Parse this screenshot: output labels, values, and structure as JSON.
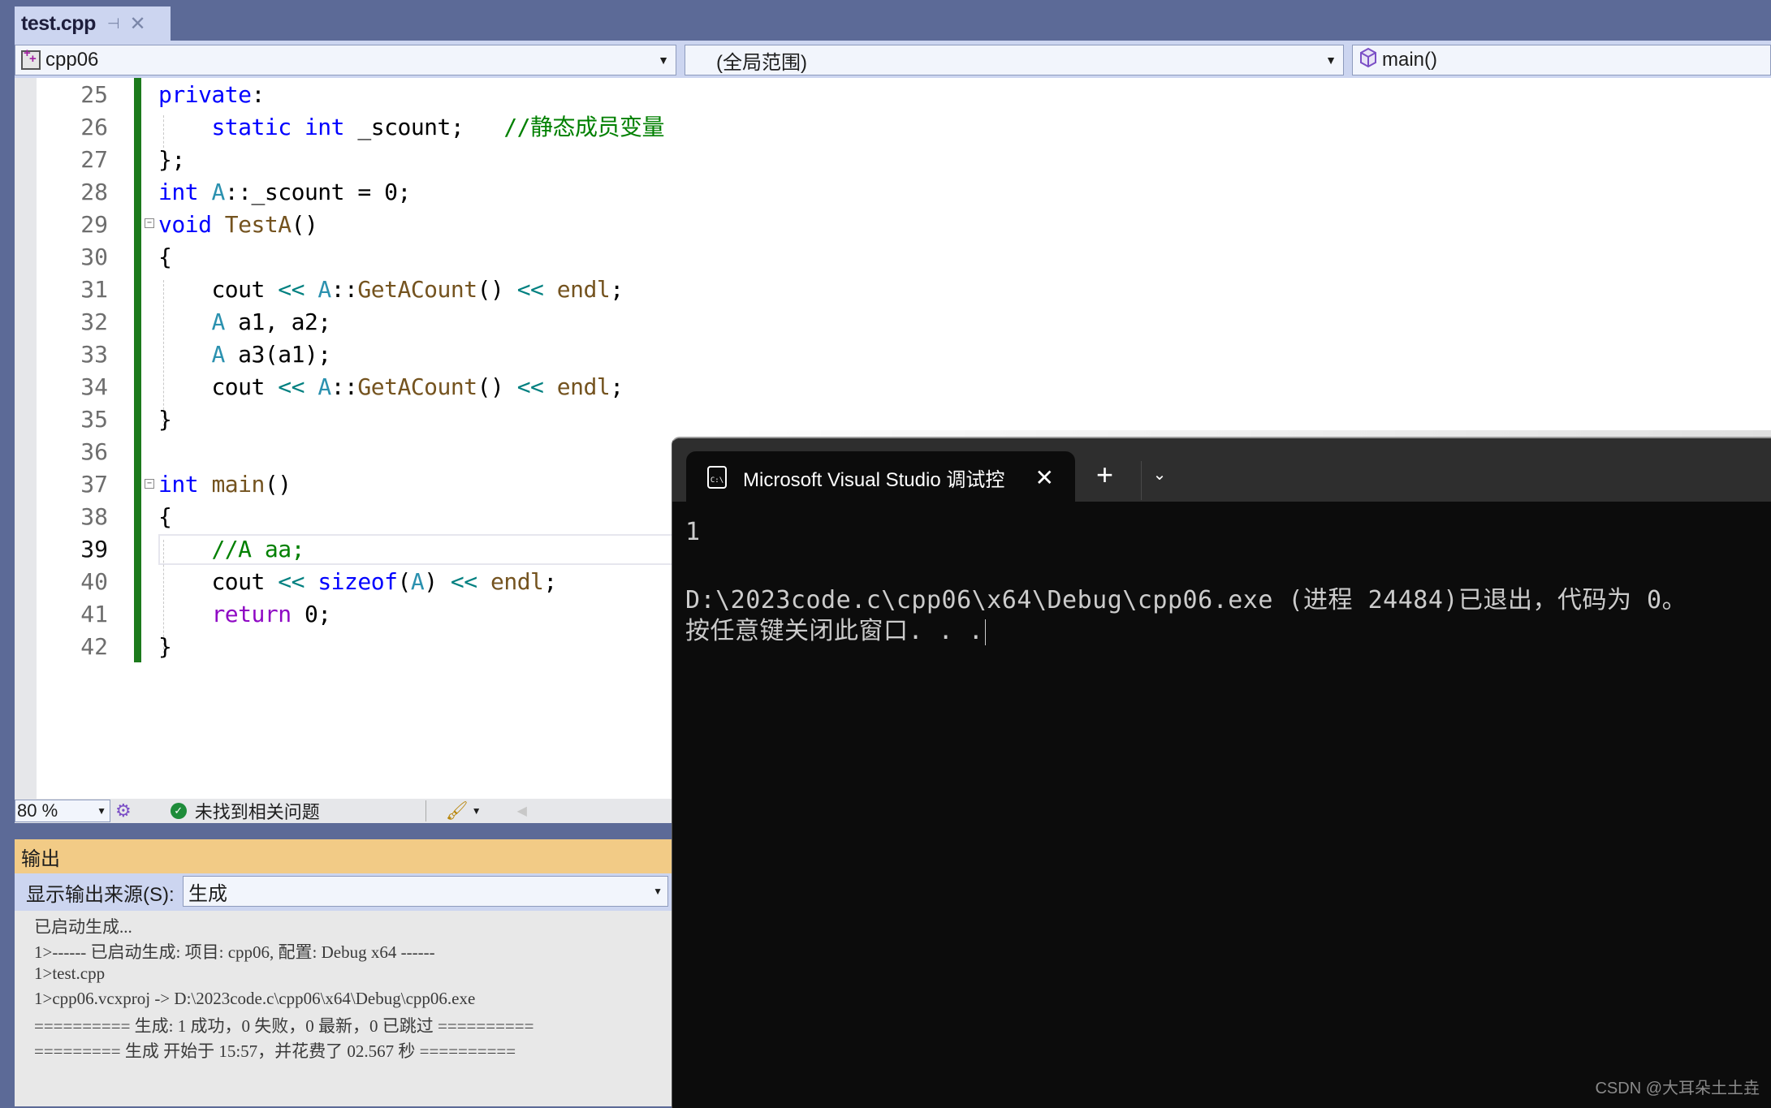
{
  "tab": {
    "title": "test.cpp",
    "pin_icon": "pin-icon",
    "close_icon": "close-icon"
  },
  "navbar": {
    "project": "cpp06",
    "scope": "(全局范围)",
    "member": "main()"
  },
  "editor": {
    "lines": [
      {
        "number": "25"
      },
      {
        "number": "26"
      },
      {
        "number": "27"
      },
      {
        "number": "28"
      },
      {
        "number": "29"
      },
      {
        "number": "30"
      },
      {
        "number": "31"
      },
      {
        "number": "32"
      },
      {
        "number": "33"
      },
      {
        "number": "34"
      },
      {
        "number": "35"
      },
      {
        "number": "36"
      },
      {
        "number": "37"
      },
      {
        "number": "38"
      },
      {
        "number": "39"
      },
      {
        "number": "40"
      },
      {
        "number": "41"
      },
      {
        "number": "42"
      }
    ],
    "code": {
      "l25": [
        "private",
        ":"
      ],
      "l26": [
        "static",
        "int",
        " _scount;   ",
        "//静态成员变量"
      ],
      "l27": "};",
      "l28": [
        "int",
        "A",
        "::_scount = 0;"
      ],
      "l29": [
        "void",
        "TestA",
        "()"
      ],
      "l30": "{",
      "l31": [
        "cout ",
        "<<",
        "A",
        "::",
        "GetACount",
        "() ",
        "<<",
        "endl",
        ";"
      ],
      "l32": [
        "A",
        " a1, a2;"
      ],
      "l33": [
        "A",
        " a3(a1);"
      ],
      "l34": [
        "cout ",
        "<<",
        "A",
        "::",
        "GetACount",
        "() ",
        "<<",
        "endl",
        ";"
      ],
      "l35": "}",
      "l37": [
        "int",
        "main",
        "()"
      ],
      "l38": "{",
      "l39": "//A aa;",
      "l40": [
        "cout ",
        "<<",
        "sizeof",
        "(",
        "A",
        ") ",
        "<<",
        "endl",
        ";"
      ],
      "l41": [
        "return",
        " 0;"
      ],
      "l42": "}"
    },
    "current_line": "39"
  },
  "statusbar": {
    "zoom": "80 %",
    "issues": "未找到相关问题"
  },
  "output": {
    "title": "输出",
    "source_label": "显示输出来源(S):",
    "source_value": "生成",
    "lines": [
      "已启动生成...",
      "1>------ 已启动生成: 项目: cpp06, 配置: Debug x64 ------",
      "1>test.cpp",
      "1>cpp06.vcxproj -> D:\\2023code.c\\cpp06\\x64\\Debug\\cpp06.exe",
      "========== 生成: 1 成功，0 失败，0 最新，0 已跳过 ==========",
      "========= 生成 开始于 15:57，并花费了 02.567 秒 =========="
    ]
  },
  "terminal": {
    "tab_title": "Microsoft Visual Studio 调试控",
    "icon_text": "C:\\",
    "lines": [
      "1",
      "",
      "D:\\2023code.c\\cpp06\\x64\\Debug\\cpp06.exe (进程 24484)已退出，代码为 0。",
      "按任意键关闭此窗口. . ."
    ]
  },
  "watermark": "CSDN @大耳朵土土垚"
}
